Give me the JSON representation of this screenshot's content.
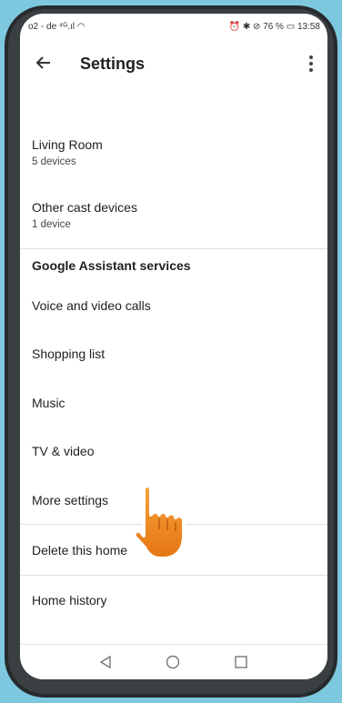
{
  "status_bar": {
    "carrier": "o2 - de",
    "right_text": "76 %",
    "time": "13:58"
  },
  "app_bar": {
    "title": "Settings",
    "back_icon": "arrow-left-icon",
    "menu_icon": "more-vert-icon"
  },
  "devices": [
    {
      "title": "Living Room",
      "subtitle": "5 devices"
    },
    {
      "title": "Other cast devices",
      "subtitle": "1 device"
    }
  ],
  "assistant_section": {
    "header": "Google Assistant services",
    "items": [
      "Voice and video calls",
      "Shopping list",
      "Music",
      "TV & video",
      "More settings"
    ]
  },
  "home_actions": [
    "Delete this home",
    "Home history"
  ],
  "nav_bar": {
    "icons": [
      "back-triangle-icon",
      "home-circle-icon",
      "recents-square-icon"
    ]
  },
  "overlay": {
    "icon": "pointing-hand-icon",
    "accent": "#f08c1e"
  }
}
